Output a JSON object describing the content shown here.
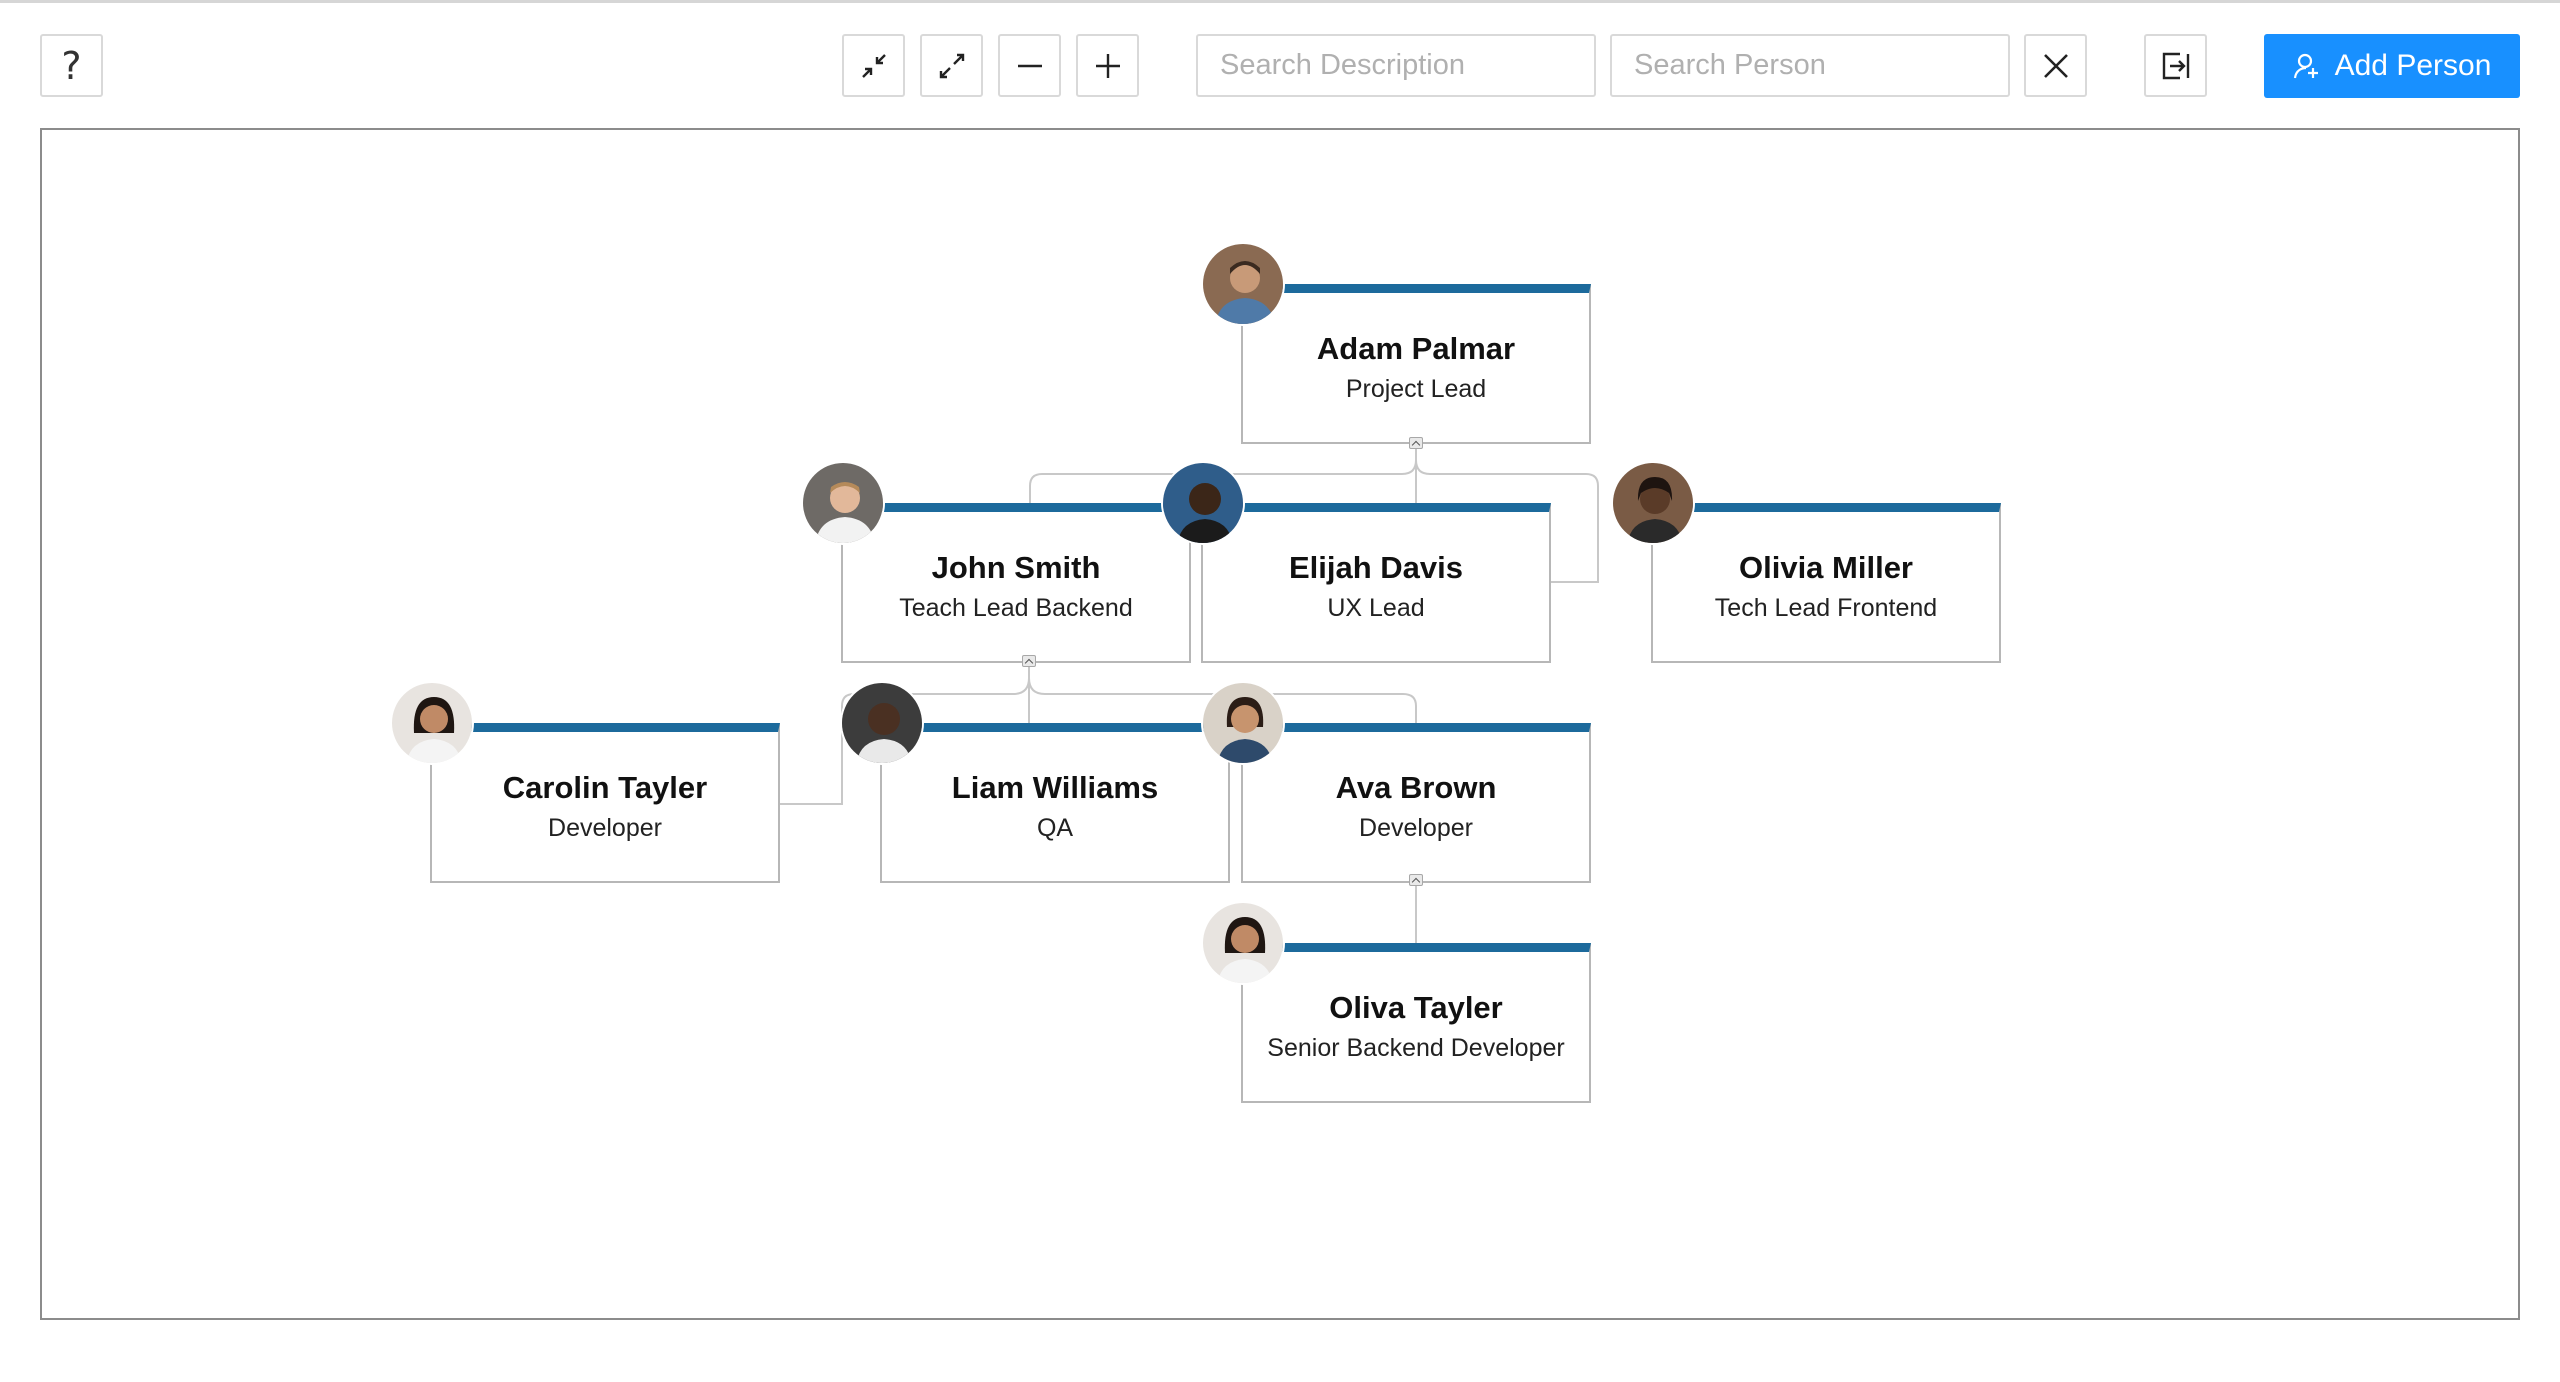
{
  "toolbar": {
    "search_description_placeholder": "Search Description",
    "search_person_placeholder": "Search Person",
    "add_person_label": "Add Person"
  },
  "colors": {
    "accent": "#1890ff",
    "node_bar": "#1c6a9c"
  },
  "icons": [
    "help-icon",
    "collapse-icon",
    "expand-icon",
    "zoom-out-icon",
    "zoom-in-icon",
    "chevron-down-icon",
    "close-icon",
    "export-icon",
    "add-person-icon"
  ],
  "org": {
    "adam": {
      "name": "Adam Palmar",
      "title": "Project Lead"
    },
    "john": {
      "name": "John Smith",
      "title": "Teach Lead Backend"
    },
    "elijah": {
      "name": "Elijah Davis",
      "title": "UX Lead"
    },
    "olivia": {
      "name": "Olivia Miller",
      "title": "Tech Lead Frontend"
    },
    "carolin": {
      "name": "Carolin Tayler",
      "title": "Developer"
    },
    "liam": {
      "name": "Liam Williams",
      "title": "QA"
    },
    "ava": {
      "name": "Ava Brown",
      "title": "Developer"
    },
    "oliva": {
      "name": "Oliva Tayler",
      "title": "Senior Backend Developer"
    }
  }
}
